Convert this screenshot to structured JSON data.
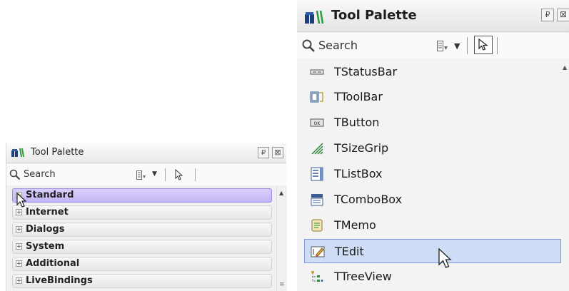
{
  "small_palette": {
    "title": "Tool Palette",
    "search_placeholder": "Search",
    "pin_glyph": "₽",
    "close_glyph": "⊠",
    "categories": [
      {
        "label": "Standard",
        "selected": true
      },
      {
        "label": "Internet",
        "selected": false
      },
      {
        "label": "Dialogs",
        "selected": false
      },
      {
        "label": "System",
        "selected": false
      },
      {
        "label": "Additional",
        "selected": false
      },
      {
        "label": "LiveBindings",
        "selected": false
      }
    ]
  },
  "large_palette": {
    "title": "Tool Palette",
    "search_placeholder": "Search",
    "pin_glyph": "₽",
    "close_glyph": "⊠",
    "components": [
      {
        "label": "TStatusBar",
        "icon": "statusbar-icon"
      },
      {
        "label": "TToolBar",
        "icon": "toolbar-icon"
      },
      {
        "label": "TButton",
        "icon": "button-icon"
      },
      {
        "label": "TSizeGrip",
        "icon": "sizegrip-icon"
      },
      {
        "label": "TListBox",
        "icon": "listbox-icon"
      },
      {
        "label": "TComboBox",
        "icon": "combobox-icon"
      },
      {
        "label": "TMemo",
        "icon": "memo-icon"
      },
      {
        "label": "TEdit",
        "icon": "edit-icon",
        "selected": true
      },
      {
        "label": "TTreeView",
        "icon": "treeview-icon"
      }
    ]
  },
  "colors": {
    "selected_category": "#c4b6f4",
    "selected_item": "#cfdcf5",
    "selected_item_border": "#7d9bd6"
  }
}
